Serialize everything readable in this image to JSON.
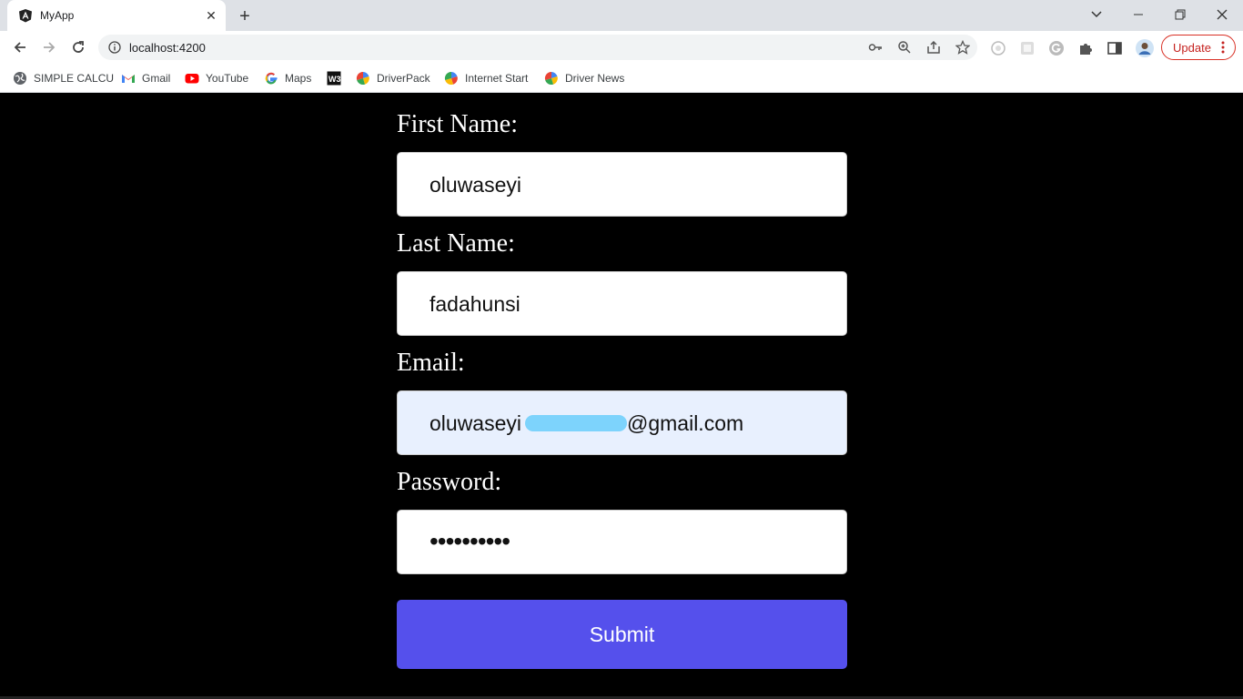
{
  "browser": {
    "tab_title": "MyApp",
    "url": "localhost:4200",
    "update_label": "Update",
    "bookmarks": [
      {
        "label": "SIMPLE CALCU",
        "icon": "globe-icon"
      },
      {
        "label": "Gmail",
        "icon": "gmail-icon"
      },
      {
        "label": "YouTube",
        "icon": "youtube-icon"
      },
      {
        "label": "Maps",
        "icon": "google-icon"
      },
      {
        "label": "",
        "icon": "w3-icon"
      },
      {
        "label": "DriverPack",
        "icon": "driverpack-icon"
      },
      {
        "label": "Internet Start",
        "icon": "internet-start-icon"
      },
      {
        "label": "Driver News",
        "icon": "driverpack-icon"
      }
    ]
  },
  "form": {
    "first_name_label": "First Name:",
    "first_name_value": "oluwaseyi",
    "last_name_label": "Last Name:",
    "last_name_value": "fadahunsi",
    "email_label": "Email:",
    "email_value_start": "oluwaseyi",
    "email_value_end": "@gmail.com",
    "password_label": "Password:",
    "password_value": "••••••••••",
    "submit_label": "Submit"
  },
  "colors": {
    "page_background": "#000000",
    "submit_button": "#5550ec",
    "autofill_field": "#e8f0fe",
    "redaction": "#7dd3fc",
    "update_accent": "#d93025"
  }
}
